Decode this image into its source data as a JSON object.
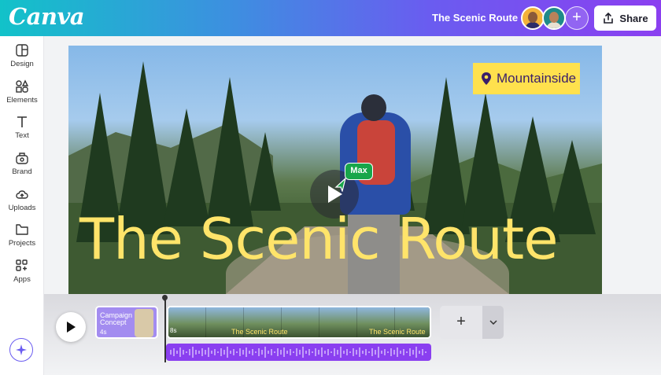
{
  "header": {
    "logo": "Canva",
    "doc_title": "The Scenic Route",
    "add_collaborator": "+",
    "share_label": "Share"
  },
  "sidebar": {
    "items": [
      {
        "label": "Design",
        "icon": "layout-icon"
      },
      {
        "label": "Elements",
        "icon": "shapes-icon"
      },
      {
        "label": "Text",
        "icon": "text-icon"
      },
      {
        "label": "Brand",
        "icon": "brand-icon"
      },
      {
        "label": "Uploads",
        "icon": "cloud-upload-icon"
      },
      {
        "label": "Projects",
        "icon": "folder-icon"
      },
      {
        "label": "Apps",
        "icon": "apps-icon"
      }
    ],
    "magic_icon": "sparkle-icon"
  },
  "canvas": {
    "location_label": "Mountainside",
    "cursor_label": "Max",
    "title_text": "The Scenic Route"
  },
  "timeline": {
    "clip1_title": "Campaign Concept",
    "clip1_duration": "4s",
    "clip2_duration": "8s",
    "clip2_title": "The Scenic Route",
    "add_clip": "+"
  },
  "colors": {
    "accent": "#8b3ff0",
    "title_yellow": "#ffe46a",
    "cursor_green": "#18a64a",
    "tag_yellow": "#ffe14d"
  }
}
